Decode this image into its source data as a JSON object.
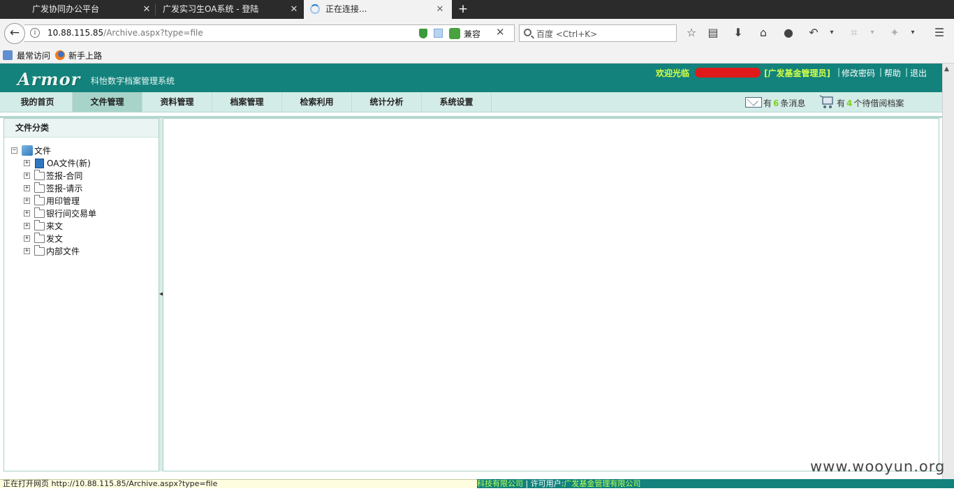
{
  "browser": {
    "tabs": [
      {
        "title": "广发协同办公平台"
      },
      {
        "title": "广发实习生OA系统 - 登陆"
      },
      {
        "title": "正在连接..."
      }
    ],
    "url_host": "10.88.115.85",
    "url_path": "/Archive.aspx?type=file",
    "compat_label": "兼容",
    "search_placeholder": "百度 <Ctrl+K>",
    "bookmarks": [
      "最常访问",
      "新手上路"
    ]
  },
  "header": {
    "logo": "Armor",
    "system_title": "科怡数字档案管理系统",
    "welcome": "欢迎光临",
    "role": "[广发基金管理员]",
    "links": [
      "修改密码",
      "帮助",
      "退出"
    ],
    "separator": "|"
  },
  "menu": {
    "items": [
      "我的首页",
      "文件管理",
      "资料管理",
      "档案管理",
      "检索利用",
      "统计分析",
      "系统设置"
    ],
    "active": "文件管理"
  },
  "notices": {
    "messages_prefix": "有",
    "messages_count": "6",
    "messages_suffix": "条消息",
    "borrow_prefix": "有",
    "borrow_count": "4",
    "borrow_suffix": "个待借阅档案"
  },
  "sidebar": {
    "title": "文件分类",
    "root": "文件",
    "expander": "⊟",
    "children": [
      "OA文件(新)",
      "签报-合同",
      "签报-请示",
      "用印管理",
      "银行间交易单",
      "来文",
      "发文",
      "内部文件"
    ]
  },
  "status": {
    "loading": "正在打开网页 http://10.88.115.85/Archive.aspx?type=file",
    "footer_prefix": "科技有限公司",
    "footer_mid": " | 许可用户:",
    "footer_company": "广发基金管理有限公司"
  },
  "watermark": "www.wooyun.org",
  "colors": {
    "header_bg": "#13827c",
    "menu_bg": "#d4ece7",
    "menu_active": "#a7d3c9",
    "highlight": "#d5ff44",
    "count_green": "#7ed321"
  }
}
